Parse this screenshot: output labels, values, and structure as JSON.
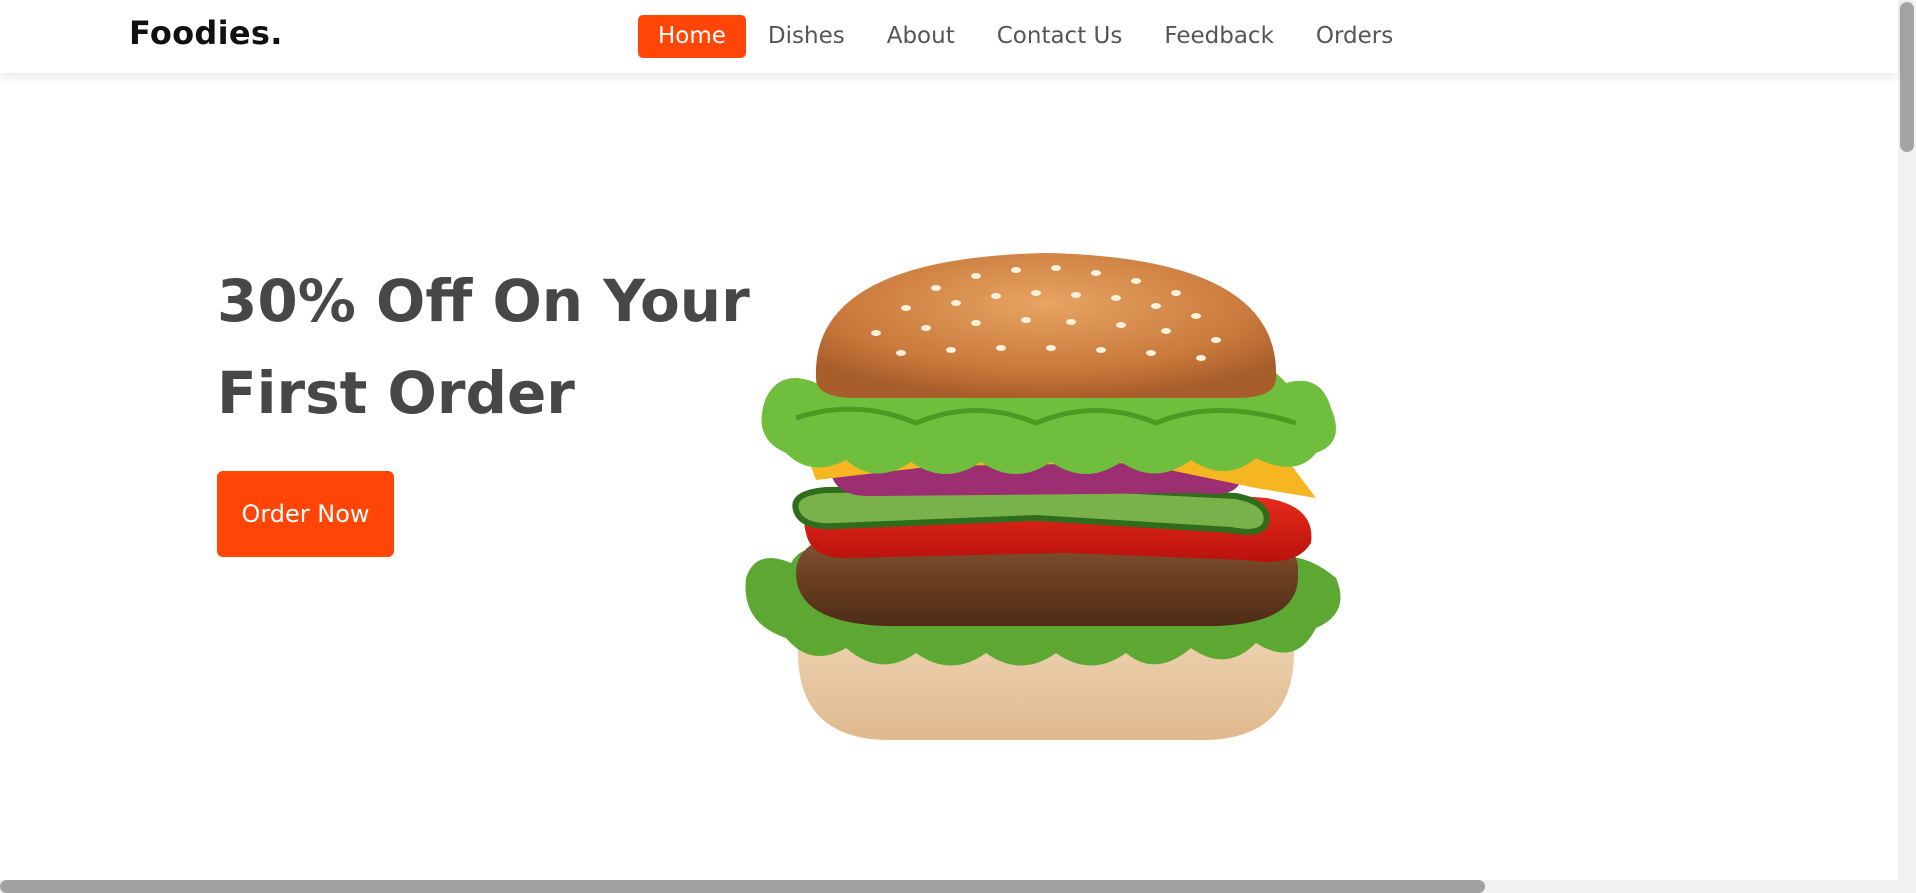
{
  "brand": {
    "name": "Foodies."
  },
  "nav": {
    "items": [
      {
        "label": "Home",
        "active": true
      },
      {
        "label": "Dishes",
        "active": false
      },
      {
        "label": "About",
        "active": false
      },
      {
        "label": "Contact Us",
        "active": false
      },
      {
        "label": "Feedback",
        "active": false
      },
      {
        "label": "Orders",
        "active": false
      }
    ]
  },
  "hero": {
    "title_line1": "30% Off On Your",
    "title_line2": "First Order",
    "cta_label": "Order Now",
    "image_icon": "burger-image"
  },
  "colors": {
    "accent": "#ff4606",
    "heading": "#474747",
    "nav_text": "#555555"
  }
}
